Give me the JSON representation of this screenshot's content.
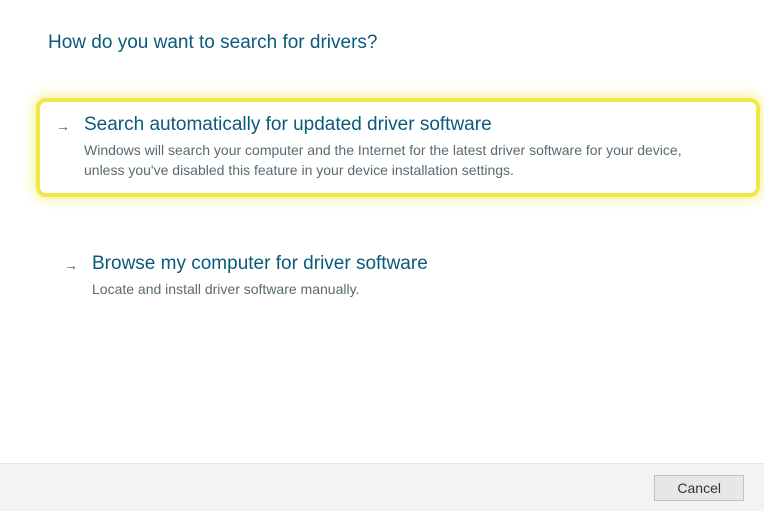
{
  "heading": "How do you want to search for drivers?",
  "options": [
    {
      "title": "Search automatically for updated driver software",
      "description": "Windows will search your computer and the Internet for the latest driver software for your device, unless you've disabled this feature in your device installation settings.",
      "highlighted": true
    },
    {
      "title": "Browse my computer for driver software",
      "description": "Locate and install driver software manually.",
      "highlighted": false
    }
  ],
  "footer": {
    "cancel_label": "Cancel"
  }
}
